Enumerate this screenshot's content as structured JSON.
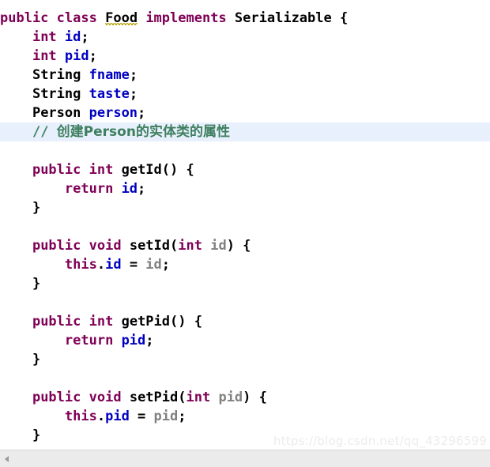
{
  "editor": {
    "language": "java",
    "colors": {
      "background": "#ffffff",
      "keyword": "#7f0055",
      "field": "#0000c0",
      "parameter": "#808080",
      "comment": "#3f7f5f",
      "plain": "#000000",
      "current_line_highlight": "#e7f0fc",
      "warning_squiggle": "#b8a000",
      "scrollbar_track": "#ebebeb"
    },
    "lines": [
      {
        "n": 1,
        "highlight": false,
        "tokens": [
          {
            "t": "public",
            "c": "kw"
          },
          {
            "t": " ",
            "c": "plain"
          },
          {
            "t": "class",
            "c": "kw"
          },
          {
            "t": " ",
            "c": "plain"
          },
          {
            "t": "Food",
            "c": "squiggle"
          },
          {
            "t": " ",
            "c": "plain"
          },
          {
            "t": "implements",
            "c": "kw"
          },
          {
            "t": " ",
            "c": "plain"
          },
          {
            "t": "Serializable {",
            "c": "plain"
          }
        ]
      },
      {
        "n": 2,
        "highlight": false,
        "tokens": [
          {
            "t": "    ",
            "c": "plain"
          },
          {
            "t": "int",
            "c": "kw"
          },
          {
            "t": " ",
            "c": "plain"
          },
          {
            "t": "id",
            "c": "field"
          },
          {
            "t": ";",
            "c": "plain"
          }
        ]
      },
      {
        "n": 3,
        "highlight": false,
        "tokens": [
          {
            "t": "    ",
            "c": "plain"
          },
          {
            "t": "int",
            "c": "kw"
          },
          {
            "t": " ",
            "c": "plain"
          },
          {
            "t": "pid",
            "c": "field"
          },
          {
            "t": ";",
            "c": "plain"
          }
        ]
      },
      {
        "n": 4,
        "highlight": false,
        "tokens": [
          {
            "t": "    ",
            "c": "plain"
          },
          {
            "t": "String",
            "c": "type"
          },
          {
            "t": " ",
            "c": "plain"
          },
          {
            "t": "fname",
            "c": "field"
          },
          {
            "t": ";",
            "c": "plain"
          }
        ]
      },
      {
        "n": 5,
        "highlight": false,
        "tokens": [
          {
            "t": "    ",
            "c": "plain"
          },
          {
            "t": "String",
            "c": "type"
          },
          {
            "t": " ",
            "c": "plain"
          },
          {
            "t": "taste",
            "c": "field"
          },
          {
            "t": ";",
            "c": "plain"
          }
        ]
      },
      {
        "n": 6,
        "highlight": false,
        "tokens": [
          {
            "t": "    ",
            "c": "plain"
          },
          {
            "t": "Person",
            "c": "type"
          },
          {
            "t": " ",
            "c": "plain"
          },
          {
            "t": "person",
            "c": "field"
          },
          {
            "t": ";",
            "c": "plain"
          }
        ]
      },
      {
        "n": 7,
        "highlight": true,
        "tokens": [
          {
            "t": "    ",
            "c": "plain"
          },
          {
            "t": "// ",
            "c": "comment"
          },
          {
            "t": "创建Person的实体类的属性",
            "c": "comment cjk"
          }
        ]
      },
      {
        "n": 8,
        "highlight": false,
        "tokens": []
      },
      {
        "n": 9,
        "highlight": false,
        "tokens": [
          {
            "t": "    ",
            "c": "plain"
          },
          {
            "t": "public",
            "c": "kw"
          },
          {
            "t": " ",
            "c": "plain"
          },
          {
            "t": "int",
            "c": "kw"
          },
          {
            "t": " ",
            "c": "plain"
          },
          {
            "t": "getId() {",
            "c": "plain"
          }
        ]
      },
      {
        "n": 10,
        "highlight": false,
        "tokens": [
          {
            "t": "        ",
            "c": "plain"
          },
          {
            "t": "return",
            "c": "kw"
          },
          {
            "t": " ",
            "c": "plain"
          },
          {
            "t": "id",
            "c": "field"
          },
          {
            "t": ";",
            "c": "plain"
          }
        ]
      },
      {
        "n": 11,
        "highlight": false,
        "tokens": [
          {
            "t": "    }",
            "c": "plain"
          }
        ]
      },
      {
        "n": 12,
        "highlight": false,
        "tokens": []
      },
      {
        "n": 13,
        "highlight": false,
        "tokens": [
          {
            "t": "    ",
            "c": "plain"
          },
          {
            "t": "public",
            "c": "kw"
          },
          {
            "t": " ",
            "c": "plain"
          },
          {
            "t": "void",
            "c": "kw"
          },
          {
            "t": " ",
            "c": "plain"
          },
          {
            "t": "setId(",
            "c": "plain"
          },
          {
            "t": "int",
            "c": "kw"
          },
          {
            "t": " ",
            "c": "plain"
          },
          {
            "t": "id",
            "c": "param"
          },
          {
            "t": ") {",
            "c": "plain"
          }
        ]
      },
      {
        "n": 14,
        "highlight": false,
        "tokens": [
          {
            "t": "        ",
            "c": "plain"
          },
          {
            "t": "this",
            "c": "kw"
          },
          {
            "t": ".",
            "c": "plain"
          },
          {
            "t": "id",
            "c": "field"
          },
          {
            "t": " = ",
            "c": "plain"
          },
          {
            "t": "id",
            "c": "param"
          },
          {
            "t": ";",
            "c": "plain"
          }
        ]
      },
      {
        "n": 15,
        "highlight": false,
        "tokens": [
          {
            "t": "    }",
            "c": "plain"
          }
        ]
      },
      {
        "n": 16,
        "highlight": false,
        "tokens": []
      },
      {
        "n": 17,
        "highlight": false,
        "tokens": [
          {
            "t": "    ",
            "c": "plain"
          },
          {
            "t": "public",
            "c": "kw"
          },
          {
            "t": " ",
            "c": "plain"
          },
          {
            "t": "int",
            "c": "kw"
          },
          {
            "t": " ",
            "c": "plain"
          },
          {
            "t": "getPid() {",
            "c": "plain"
          }
        ]
      },
      {
        "n": 18,
        "highlight": false,
        "tokens": [
          {
            "t": "        ",
            "c": "plain"
          },
          {
            "t": "return",
            "c": "kw"
          },
          {
            "t": " ",
            "c": "plain"
          },
          {
            "t": "pid",
            "c": "field"
          },
          {
            "t": ";",
            "c": "plain"
          }
        ]
      },
      {
        "n": 19,
        "highlight": false,
        "tokens": [
          {
            "t": "    }",
            "c": "plain"
          }
        ]
      },
      {
        "n": 20,
        "highlight": false,
        "tokens": []
      },
      {
        "n": 21,
        "highlight": false,
        "tokens": [
          {
            "t": "    ",
            "c": "plain"
          },
          {
            "t": "public",
            "c": "kw"
          },
          {
            "t": " ",
            "c": "plain"
          },
          {
            "t": "void",
            "c": "kw"
          },
          {
            "t": " ",
            "c": "plain"
          },
          {
            "t": "setPid(",
            "c": "plain"
          },
          {
            "t": "int",
            "c": "kw"
          },
          {
            "t": " ",
            "c": "plain"
          },
          {
            "t": "pid",
            "c": "param"
          },
          {
            "t": ") {",
            "c": "plain"
          }
        ]
      },
      {
        "n": 22,
        "highlight": false,
        "tokens": [
          {
            "t": "        ",
            "c": "plain"
          },
          {
            "t": "this",
            "c": "kw"
          },
          {
            "t": ".",
            "c": "plain"
          },
          {
            "t": "pid",
            "c": "field"
          },
          {
            "t": " = ",
            "c": "plain"
          },
          {
            "t": "pid",
            "c": "param"
          },
          {
            "t": ";",
            "c": "plain"
          }
        ]
      },
      {
        "n": 23,
        "highlight": false,
        "tokens": [
          {
            "t": "    }",
            "c": "plain"
          }
        ]
      }
    ]
  },
  "watermark": {
    "text": "https://blog.csdn.net/qq_43296599"
  },
  "scrollbar": {
    "orientation": "horizontal",
    "left_arrow_icon": "triangle-left-icon"
  }
}
